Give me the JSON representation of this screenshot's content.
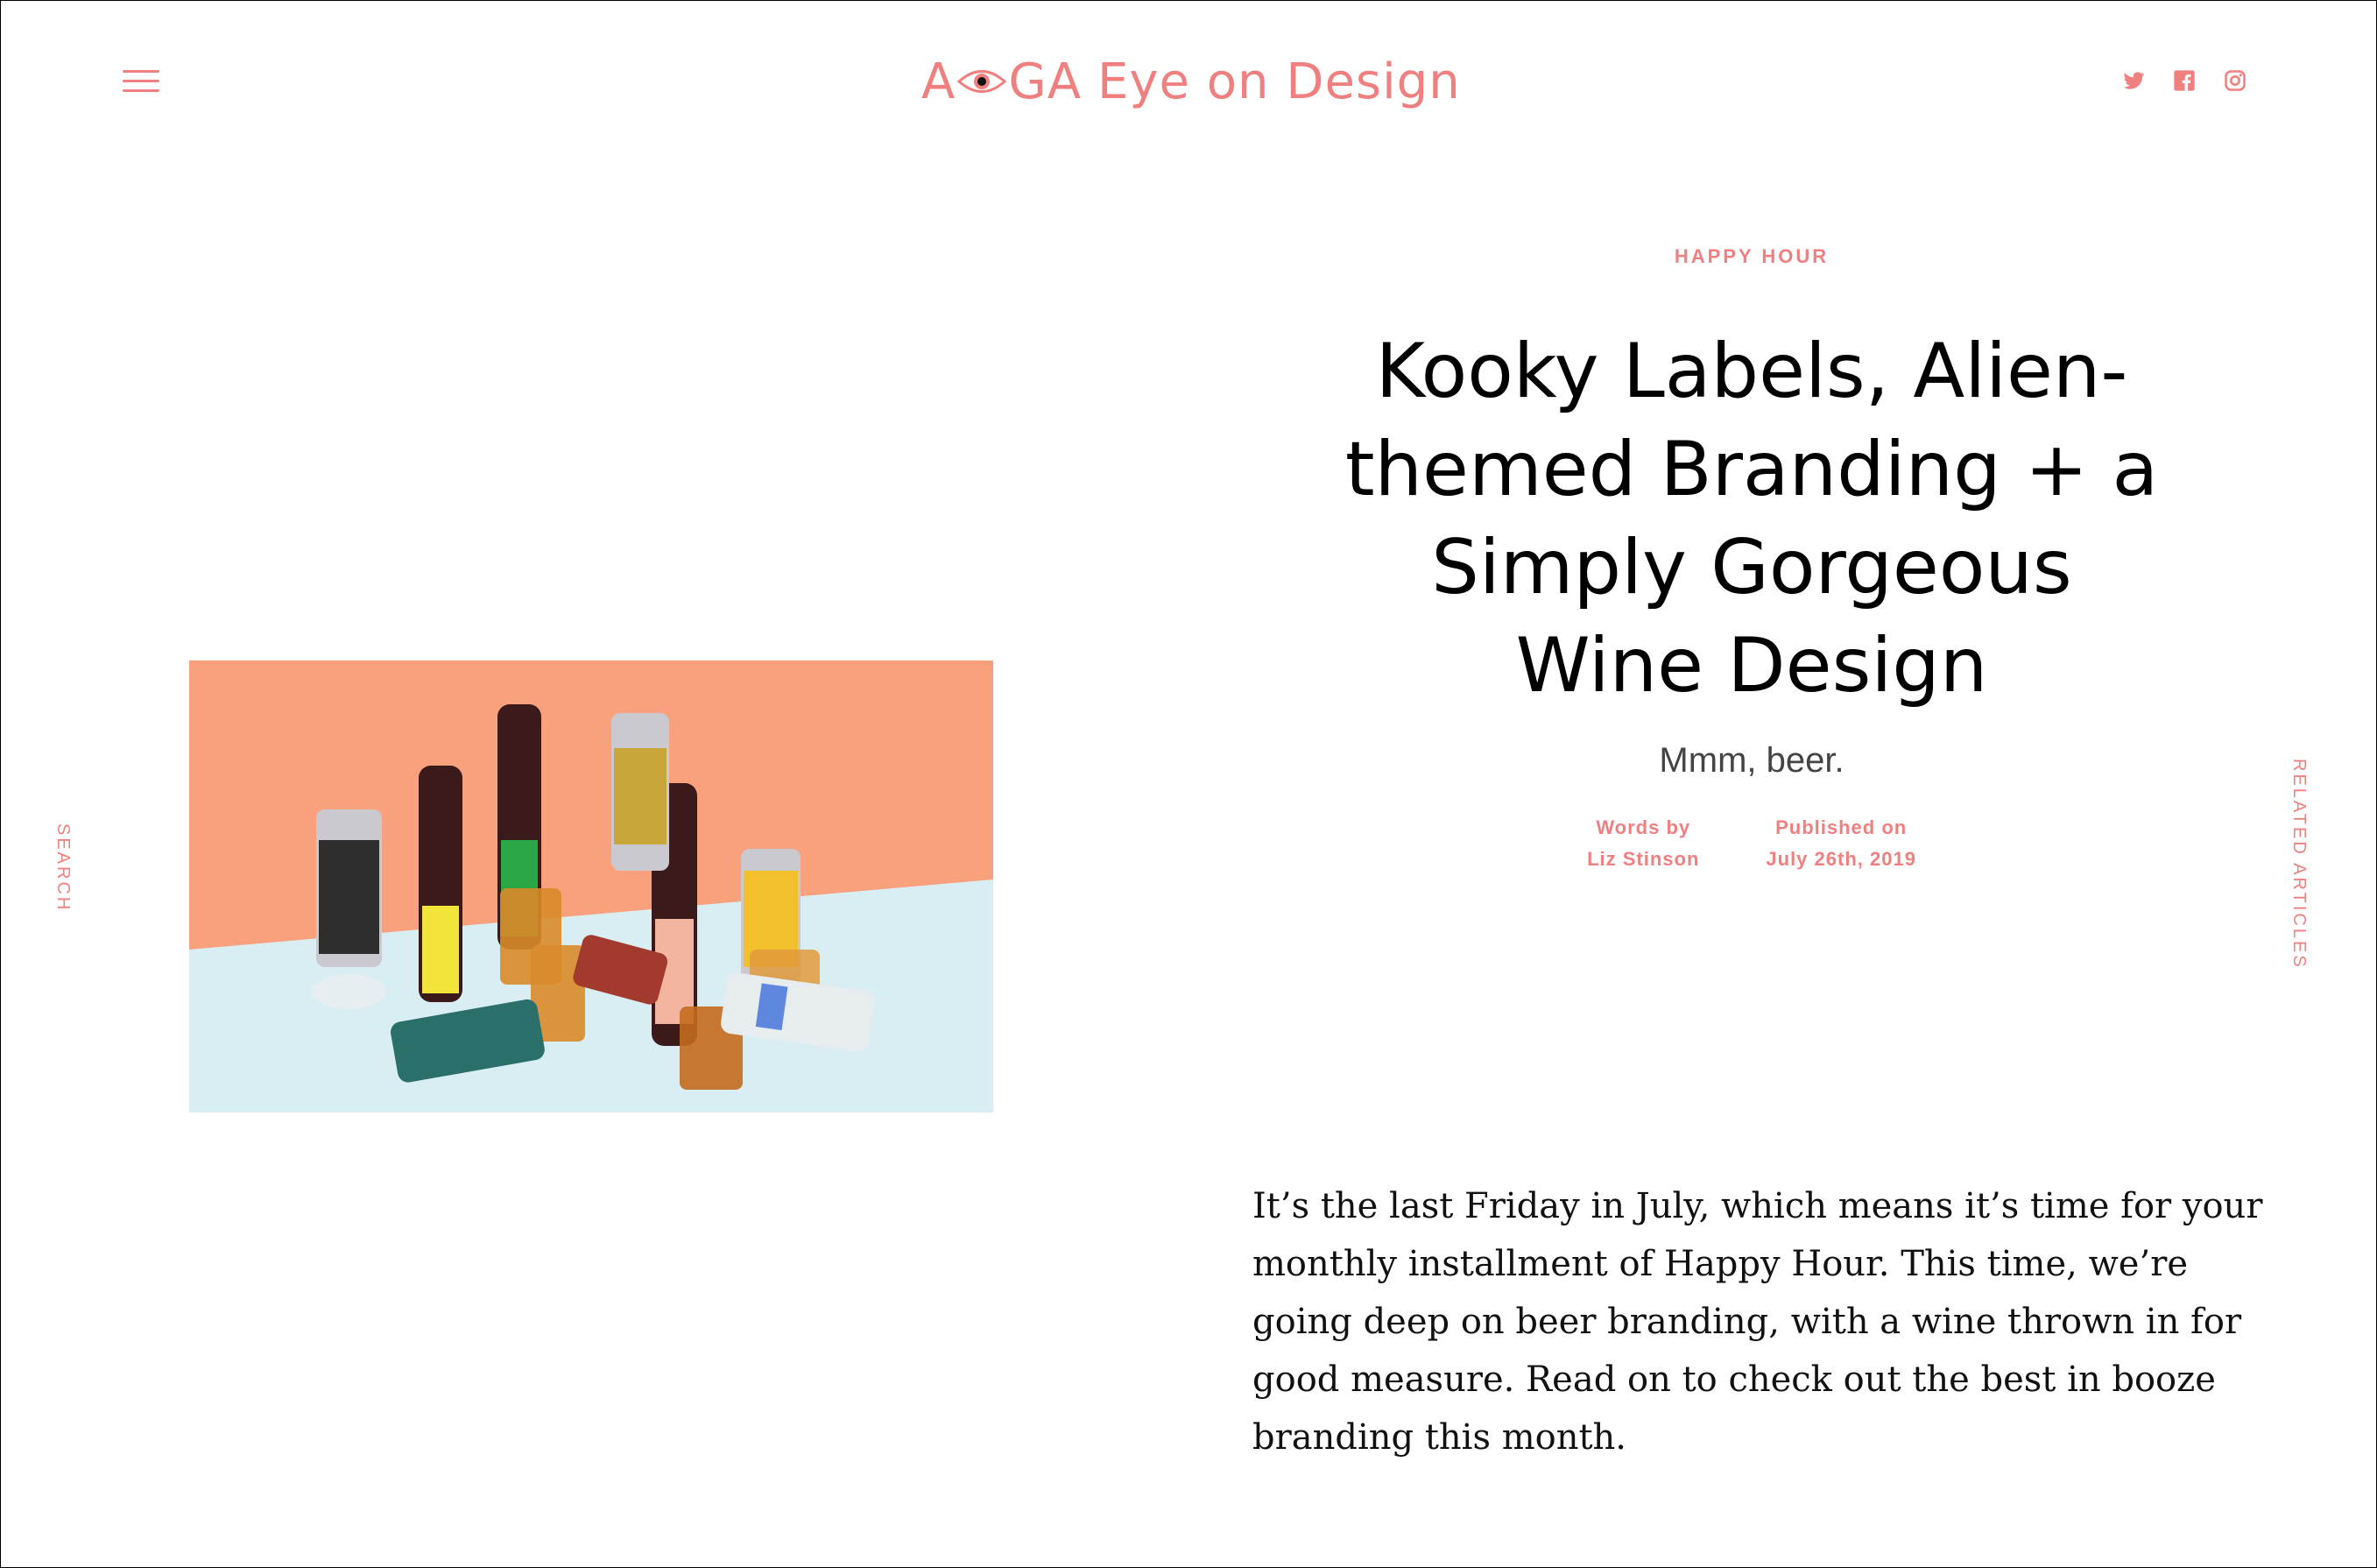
{
  "header": {
    "logo_part1": "A",
    "logo_part2": "GA",
    "logo_tagline": "Eye on Design",
    "menu_icon": "hamburger-menu-icon",
    "social": [
      "twitter-icon",
      "facebook-icon",
      "instagram-icon"
    ]
  },
  "sidebar": {
    "left_label": "SEARCH",
    "right_label": "RELATED ARTICLES"
  },
  "article": {
    "kicker": "HAPPY HOUR",
    "title": "Kooky Labels, Alien-themed Branding + a Simply Gorgeous Wine Design",
    "subtitle": "Mmm, beer.",
    "words_by_label": "Words by",
    "author": "Liz Stinson",
    "published_label": "Published on",
    "published_date": "July 26th, 2019",
    "body": "It’s the last Friday in July, which means it’s time for your monthly installment of Happy Hour. This time, we’re going deep on beer branding, with a wine thrown in for good measure. Read on to check out the best in booze branding this month."
  },
  "colors": {
    "accent": "#f08080",
    "hero_background": "#f9a07c",
    "hero_table": "#d9eef2"
  }
}
